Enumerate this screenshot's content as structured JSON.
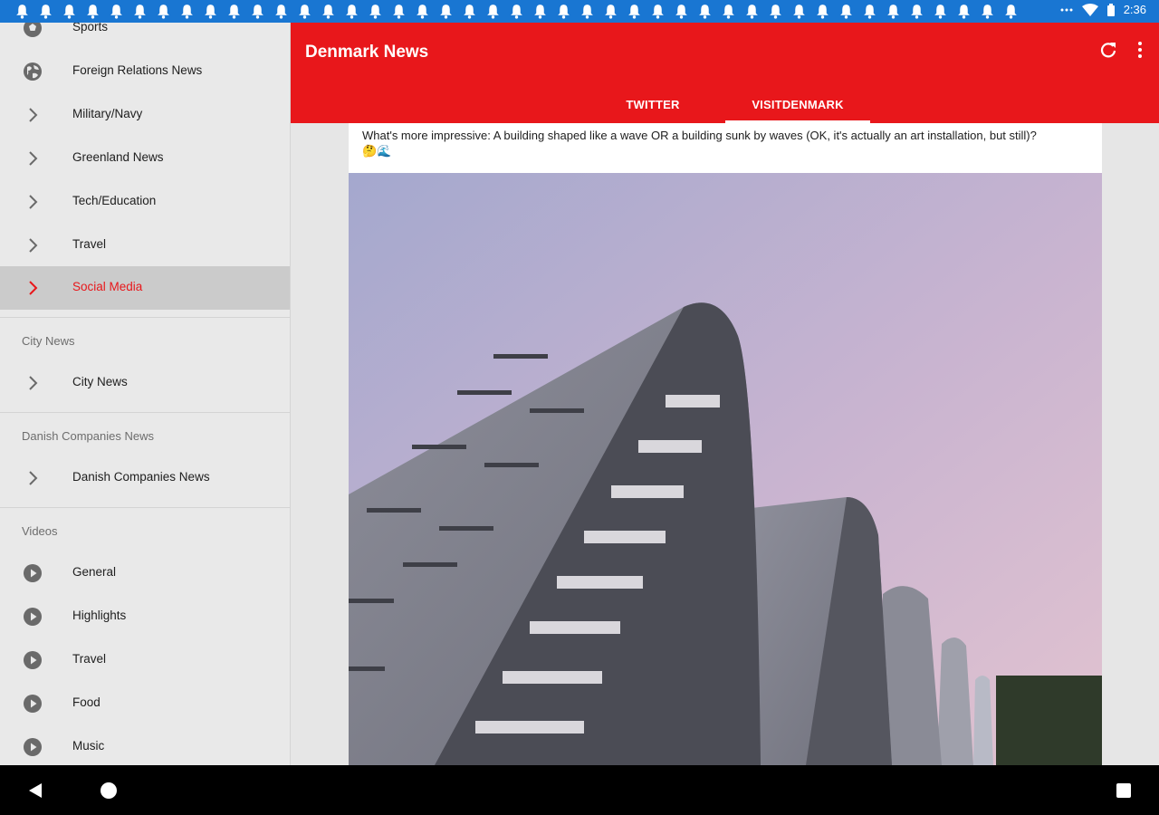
{
  "status_bar": {
    "time": "2:36",
    "notification_icon": "bell-icon",
    "notification_count": 43,
    "icons": [
      "overflow-dots-icon",
      "wifi-icon",
      "battery-icon"
    ]
  },
  "app_bar": {
    "title": "Denmark News",
    "actions": [
      "refresh-icon",
      "more-vert-icon"
    ],
    "tabs": [
      {
        "label": "TWITTER",
        "selected": false
      },
      {
        "label": "VISITDENMARK",
        "selected": true
      }
    ]
  },
  "drawer": {
    "items": [
      {
        "label": "Sports",
        "icon": "soccer-ball-icon"
      },
      {
        "label": "Foreign Relations News",
        "icon": "globe-icon"
      },
      {
        "label": "Military/Navy",
        "icon": "chevron-right-icon"
      },
      {
        "label": "Greenland News",
        "icon": "chevron-right-icon"
      },
      {
        "label": "Tech/Education",
        "icon": "chevron-right-icon"
      },
      {
        "label": "Travel",
        "icon": "chevron-right-icon"
      },
      {
        "label": "Social Media",
        "icon": "chevron-right-icon",
        "active": true
      }
    ],
    "sections": [
      {
        "header": "City News",
        "items": [
          {
            "label": "City News",
            "icon": "chevron-right-icon"
          }
        ]
      },
      {
        "header": "Danish Companies News",
        "items": [
          {
            "label": "Danish Companies News",
            "icon": "chevron-right-icon"
          }
        ]
      },
      {
        "header": "Videos",
        "items": [
          {
            "label": "General",
            "icon": "play-circle-icon"
          },
          {
            "label": "Highlights",
            "icon": "play-circle-icon"
          },
          {
            "label": "Travel",
            "icon": "play-circle-icon"
          },
          {
            "label": "Food",
            "icon": "play-circle-icon"
          },
          {
            "label": "Music",
            "icon": "play-circle-icon"
          }
        ]
      }
    ]
  },
  "feed": {
    "tweet_text": "What's more impressive: A building shaped like a wave OR a building sunk by waves (OK, it's actually an art installation, but still)?",
    "tweet_emoji": "🤔🌊",
    "image": "wave-building-photo"
  },
  "colors": {
    "accent": "#e8171b",
    "status_bar": "#1976d2",
    "drawer_bg": "#e9e9e9",
    "active_item_bg": "#cbcbcb"
  },
  "nav_bar": {
    "buttons": [
      "back-icon",
      "home-icon",
      "recents-icon"
    ]
  }
}
